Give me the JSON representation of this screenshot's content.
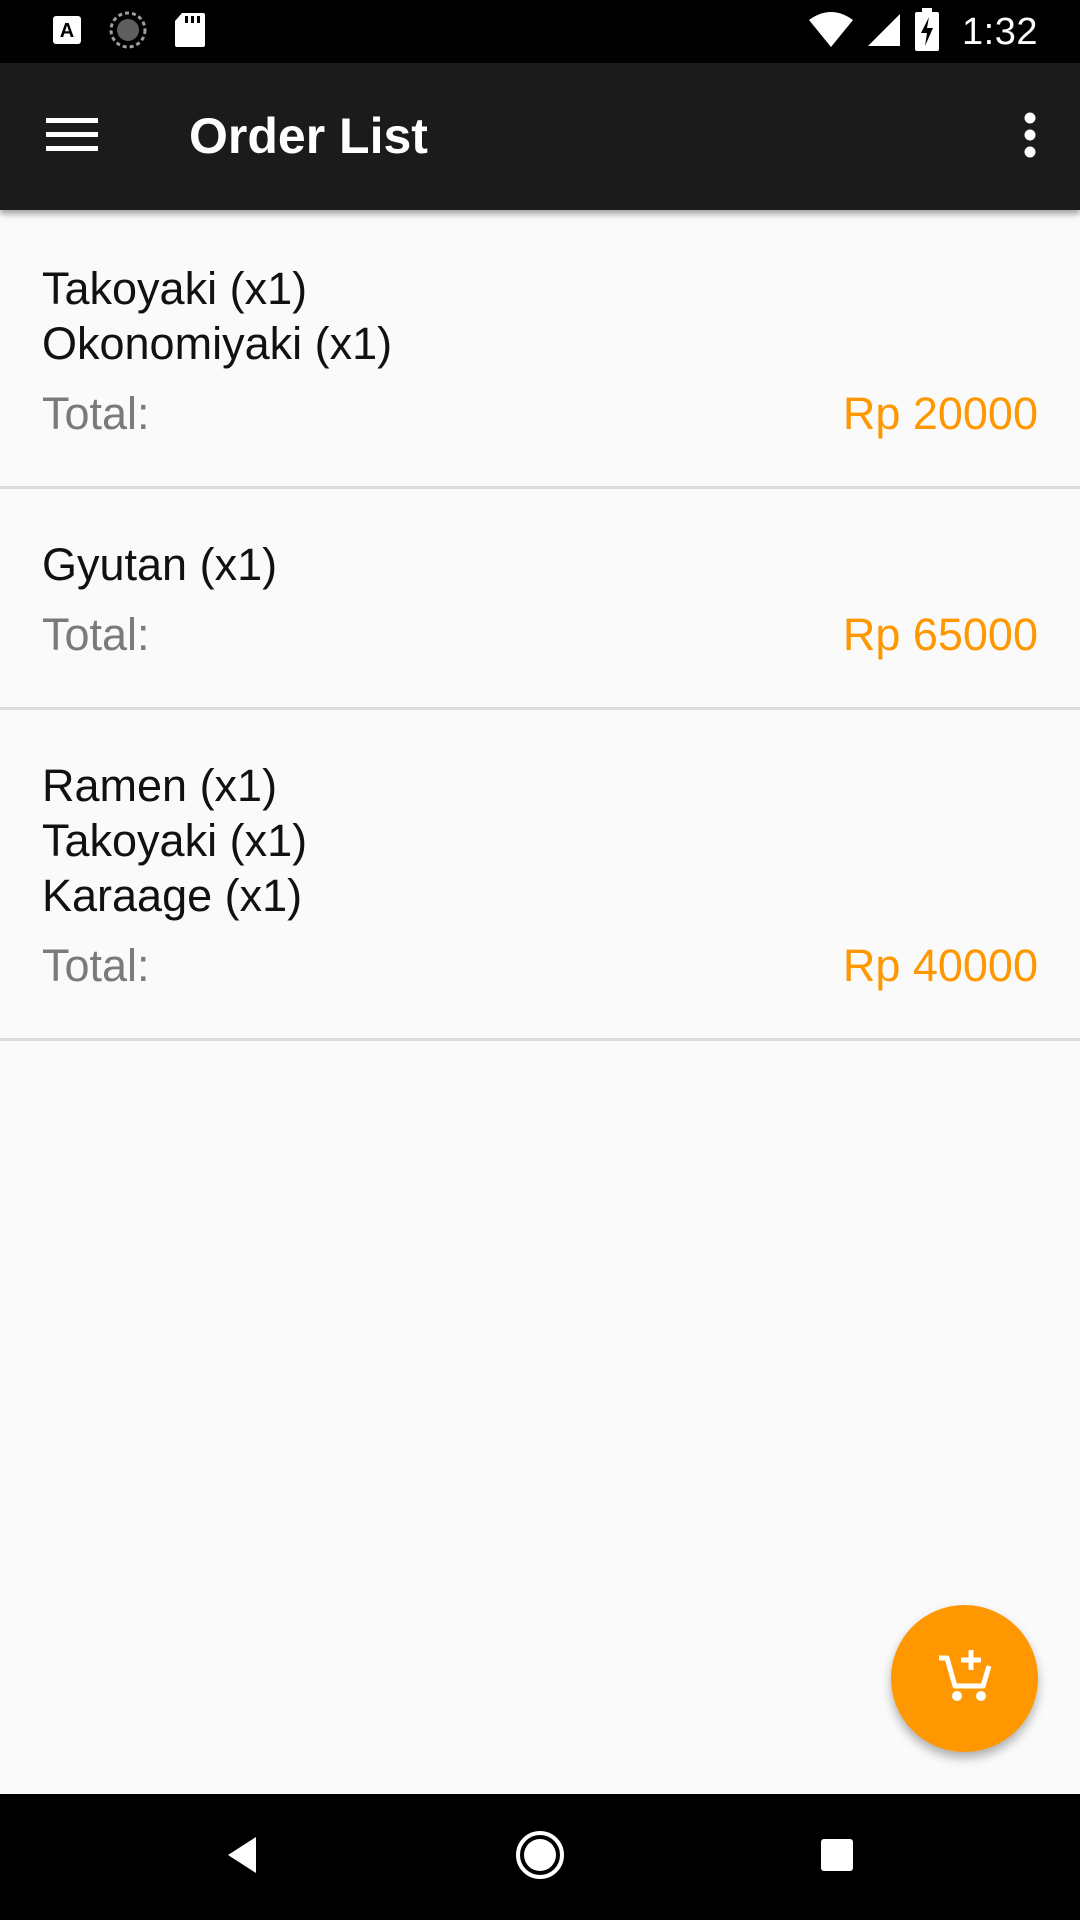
{
  "status_bar": {
    "time": "1:32",
    "left_icons": [
      "a-font-icon",
      "sync-circle-icon",
      "sd-card-icon"
    ],
    "right_icons": [
      "wifi-icon",
      "signal-icon",
      "battery-charging-icon"
    ]
  },
  "app_bar": {
    "title": "Order List",
    "menu_icon": "menu-icon",
    "overflow_icon": "more-vert-icon"
  },
  "orders": [
    {
      "items": [
        "Takoyaki (x1)",
        "Okonomiyaki (x1)"
      ],
      "total_label": "Total:",
      "total": "Rp 20000"
    },
    {
      "items": [
        "Gyutan (x1)"
      ],
      "total_label": "Total:",
      "total": "Rp 65000"
    },
    {
      "items": [
        "Ramen (x1)",
        "Takoyaki (x1)",
        "Karaage (x1)"
      ],
      "total_label": "Total:",
      "total": "Rp 40000"
    }
  ],
  "fab": {
    "icon": "add-shopping-cart-icon"
  },
  "nav_bar": {
    "buttons": [
      "back-icon",
      "home-icon",
      "recents-icon"
    ]
  },
  "colors": {
    "accent": "#ff9800",
    "app_bar": "#1b1b1b",
    "background": "#fafafa",
    "divider": "#dcdcdc"
  }
}
